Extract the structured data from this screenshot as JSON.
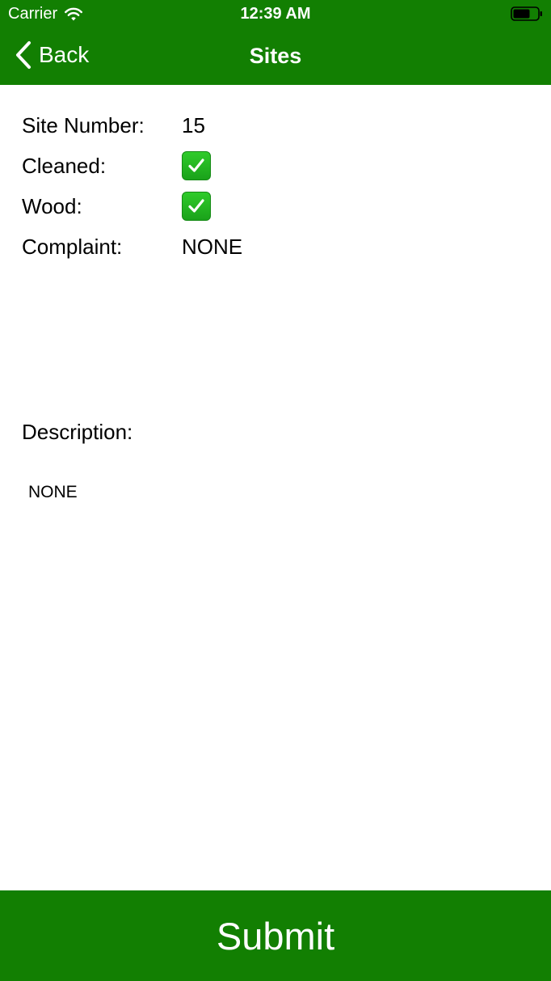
{
  "status_bar": {
    "carrier": "Carrier",
    "time": "12:39 AM"
  },
  "nav": {
    "back_label": "Back",
    "title": "Sites"
  },
  "fields": {
    "site_number": {
      "label": "Site Number:",
      "value": "15"
    },
    "cleaned": {
      "label": "Cleaned:",
      "checked": true,
      "icon": "check-mark-button-icon"
    },
    "wood": {
      "label": "Wood:",
      "checked": true,
      "icon": "check-mark-button-icon"
    },
    "complaint": {
      "label": "Complaint:",
      "value": "NONE"
    }
  },
  "description": {
    "label": "Description:",
    "value": "NONE"
  },
  "submit_label": "Submit",
  "colors": {
    "accent": "#127f02",
    "check": "#1aa21a"
  }
}
